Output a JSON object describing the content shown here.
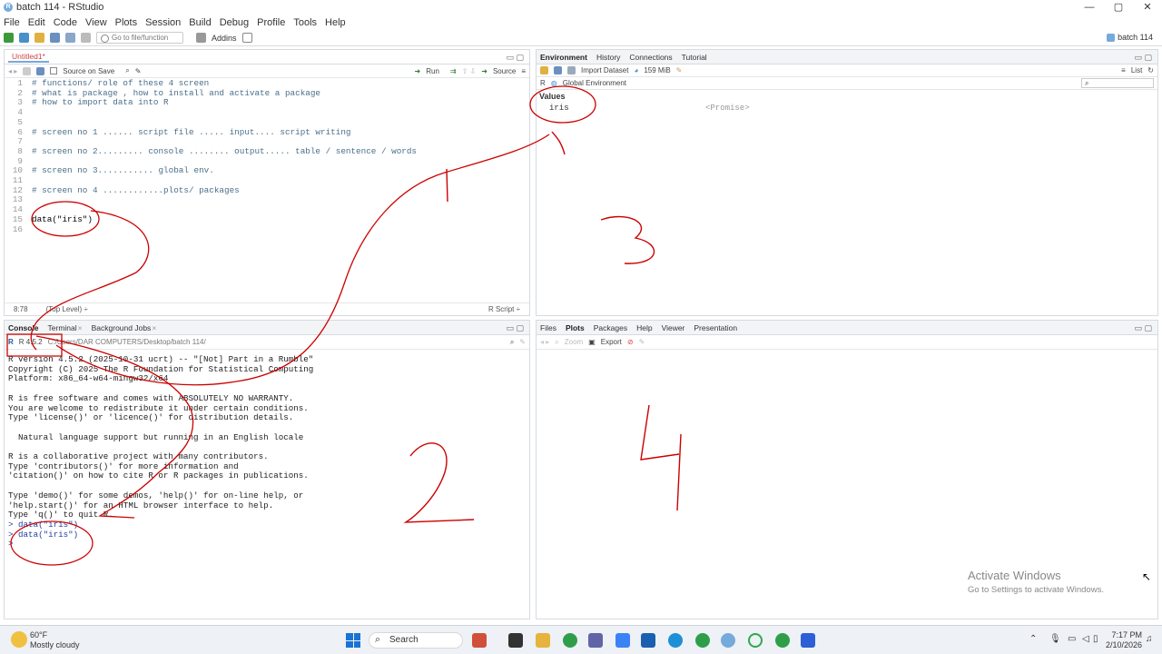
{
  "window": {
    "title": "batch 114 - RStudio",
    "controls": [
      "—",
      "▢",
      "✕"
    ]
  },
  "menu": [
    "File",
    "Edit",
    "Code",
    "View",
    "Plots",
    "Session",
    "Build",
    "Debug",
    "Profile",
    "Tools",
    "Help"
  ],
  "toolbar": {
    "goto_placeholder": "Go to file/function",
    "addins": "Addins",
    "project": "batch 114"
  },
  "editor": {
    "tab": "Untitled1*",
    "source_on_save": "Source on Save",
    "run": "Run",
    "source": "Source",
    "lines": [
      {
        "n": "1",
        "t": "# functions/ role of these 4 screen"
      },
      {
        "n": "2",
        "t": "# what is package , how to install and activate a package"
      },
      {
        "n": "3",
        "t": "# how to import data into R"
      },
      {
        "n": "4",
        "t": ""
      },
      {
        "n": "5",
        "t": ""
      },
      {
        "n": "6",
        "t": "# screen no 1 ...... script file ..... input.... script writing"
      },
      {
        "n": "7",
        "t": ""
      },
      {
        "n": "8",
        "t": "# screen no 2......... console ........ output..... table / sentence / words"
      },
      {
        "n": "9",
        "t": ""
      },
      {
        "n": "10",
        "t": "# screen no 3........... global env."
      },
      {
        "n": "11",
        "t": ""
      },
      {
        "n": "12",
        "t": "# screen no 4 ............plots/ packages"
      },
      {
        "n": "13",
        "t": ""
      },
      {
        "n": "14",
        "t": ""
      },
      {
        "n": "15",
        "t": "data(\"iris\")"
      },
      {
        "n": "16",
        "t": ""
      }
    ],
    "status_pos": "8:78",
    "status_level": "(Top Level) ÷",
    "status_type": "R Script ÷"
  },
  "console": {
    "tabs": [
      "Console",
      "Terminal",
      "Background Jobs"
    ],
    "rversion": "R 4.5.2",
    "path": "C:/Users/DAR COMPUTERS/Desktop/batch 114/",
    "output": "R version 4.5.2 (2025-10-31 ucrt) -- \"[Not] Part in a Rumble\"\nCopyright (C) 2025 The R Foundation for Statistical Computing\nPlatform: x86_64-w64-mingw32/x64\n\nR is free software and comes with ABSOLUTELY NO WARRANTY.\nYou are welcome to redistribute it under certain conditions.\nType 'license()' or 'licence()' for distribution details.\n\n  Natural language support but running in an English locale\n\nR is a collaborative project with many contributors.\nType 'contributors()' for more information and\n'citation()' on how to cite R or R packages in publications.\n\nType 'demo()' for some demos, 'help()' for on-line help, or\n'help.start()' for an HTML browser interface to help.\nType 'q()' to quit R.\n",
    "commands": [
      "> data(\"iris\")",
      "> data(\"iris\")",
      ">"
    ]
  },
  "environment": {
    "tabs": [
      "Environment",
      "History",
      "Connections",
      "Tutorial"
    ],
    "import": "Import Dataset",
    "memory": "159 MiB",
    "lang": "R",
    "scope": "Global Environment",
    "list_mode": "List",
    "section": "Values",
    "var_name": "iris",
    "var_value": "<Promise>"
  },
  "files": {
    "tabs": [
      "Files",
      "Plots",
      "Packages",
      "Help",
      "Viewer",
      "Presentation"
    ],
    "zoom": "Zoom",
    "export": "Export"
  },
  "annotations": [
    "1",
    "2",
    "3",
    "4"
  ],
  "watermark": {
    "line1": "Activate Windows",
    "line2": "Go to Settings to activate Windows."
  },
  "taskbar": {
    "weather_temp": "60°F",
    "weather_desc": "Mostly cloudy",
    "search": "Search",
    "time": "7:17 PM",
    "date": "2/10/2026"
  }
}
